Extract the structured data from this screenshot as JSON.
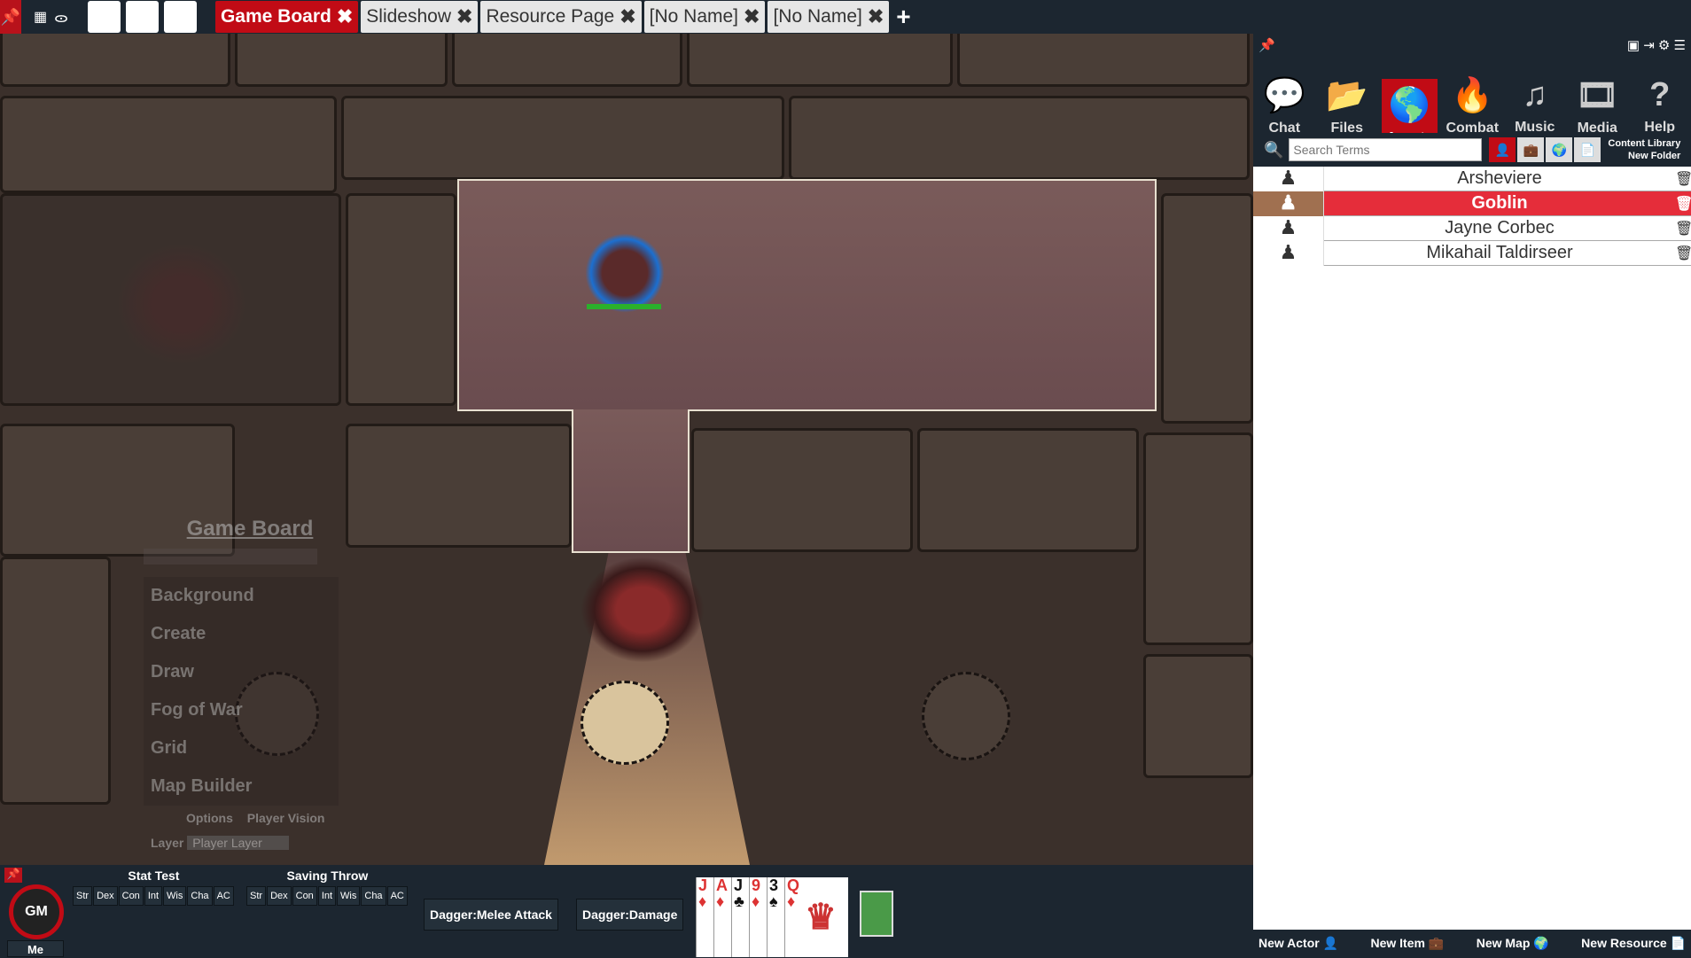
{
  "topbar": {
    "icons": [
      "pin-icon",
      "calendar-icon",
      "binoculars-icon"
    ],
    "tabs": [
      {
        "label": "Game Board",
        "active": true
      },
      {
        "label": "Slideshow"
      },
      {
        "label": "Resource Page"
      },
      {
        "label": "[No Name]"
      },
      {
        "label": "[No Name]"
      }
    ],
    "close_glyph": "✖",
    "add_glyph": "+"
  },
  "game_board_menu": {
    "title": "Game Board",
    "items": [
      "Background",
      "Create",
      "Draw",
      "Fog of War",
      "Grid",
      "Map Builder"
    ],
    "options": "Options",
    "player_vision": "Player Vision",
    "layer_label": "Layer",
    "layer_value": "Player Layer"
  },
  "right_panel": {
    "nav": [
      {
        "label": "Chat",
        "icon": "chat-icon",
        "glyph": "💬"
      },
      {
        "label": "Files",
        "icon": "folder-icon",
        "glyph": "📂"
      },
      {
        "label": "Assets",
        "icon": "globe-icon",
        "glyph": "🌎",
        "active": true
      },
      {
        "label": "Combat",
        "icon": "fire-icon",
        "glyph": "🔥"
      },
      {
        "label": "Music",
        "icon": "music-icon",
        "glyph": "♫"
      },
      {
        "label": "Media",
        "icon": "film-icon",
        "glyph": "🎞"
      },
      {
        "label": "Help",
        "icon": "help-icon",
        "glyph": "?"
      }
    ],
    "search_placeholder": "Search Terms",
    "content_library": "Content Library",
    "new_folder": "New Folder",
    "assets": [
      {
        "name": "Arsheviere"
      },
      {
        "name": "Goblin",
        "selected": true
      },
      {
        "name": "Jayne Corbec"
      },
      {
        "name": "Mikahail Taldirseer"
      }
    ],
    "footer": [
      "New Actor",
      "New Item",
      "New Map",
      "New Resource"
    ],
    "accent": "#c10b15",
    "selected_row": "#e52d3a"
  },
  "bottom": {
    "avatar_text": "GM",
    "me": "Me",
    "stat_test": {
      "title": "Stat Test",
      "buttons": [
        "Str",
        "Dex",
        "Con",
        "Int",
        "Wis",
        "Cha",
        "AC"
      ]
    },
    "saving_throw": {
      "title": "Saving Throw",
      "buttons": [
        "Str",
        "Dex",
        "Con",
        "Int",
        "Wis",
        "Cha",
        "AC"
      ]
    },
    "actions": [
      "Dagger:Melee Attack",
      "Dagger:Damage"
    ],
    "cards": [
      {
        "rank": "J",
        "suit": "♦",
        "color": "#d33"
      },
      {
        "rank": "A",
        "suit": "♦",
        "color": "#d33"
      },
      {
        "rank": "J",
        "suit": "♣",
        "color": "#111"
      },
      {
        "rank": "9",
        "suit": "♦",
        "color": "#d33"
      },
      {
        "rank": "3",
        "suit": "♠",
        "color": "#111"
      },
      {
        "rank": "Q",
        "suit": "♦",
        "color": "#d33"
      }
    ]
  }
}
